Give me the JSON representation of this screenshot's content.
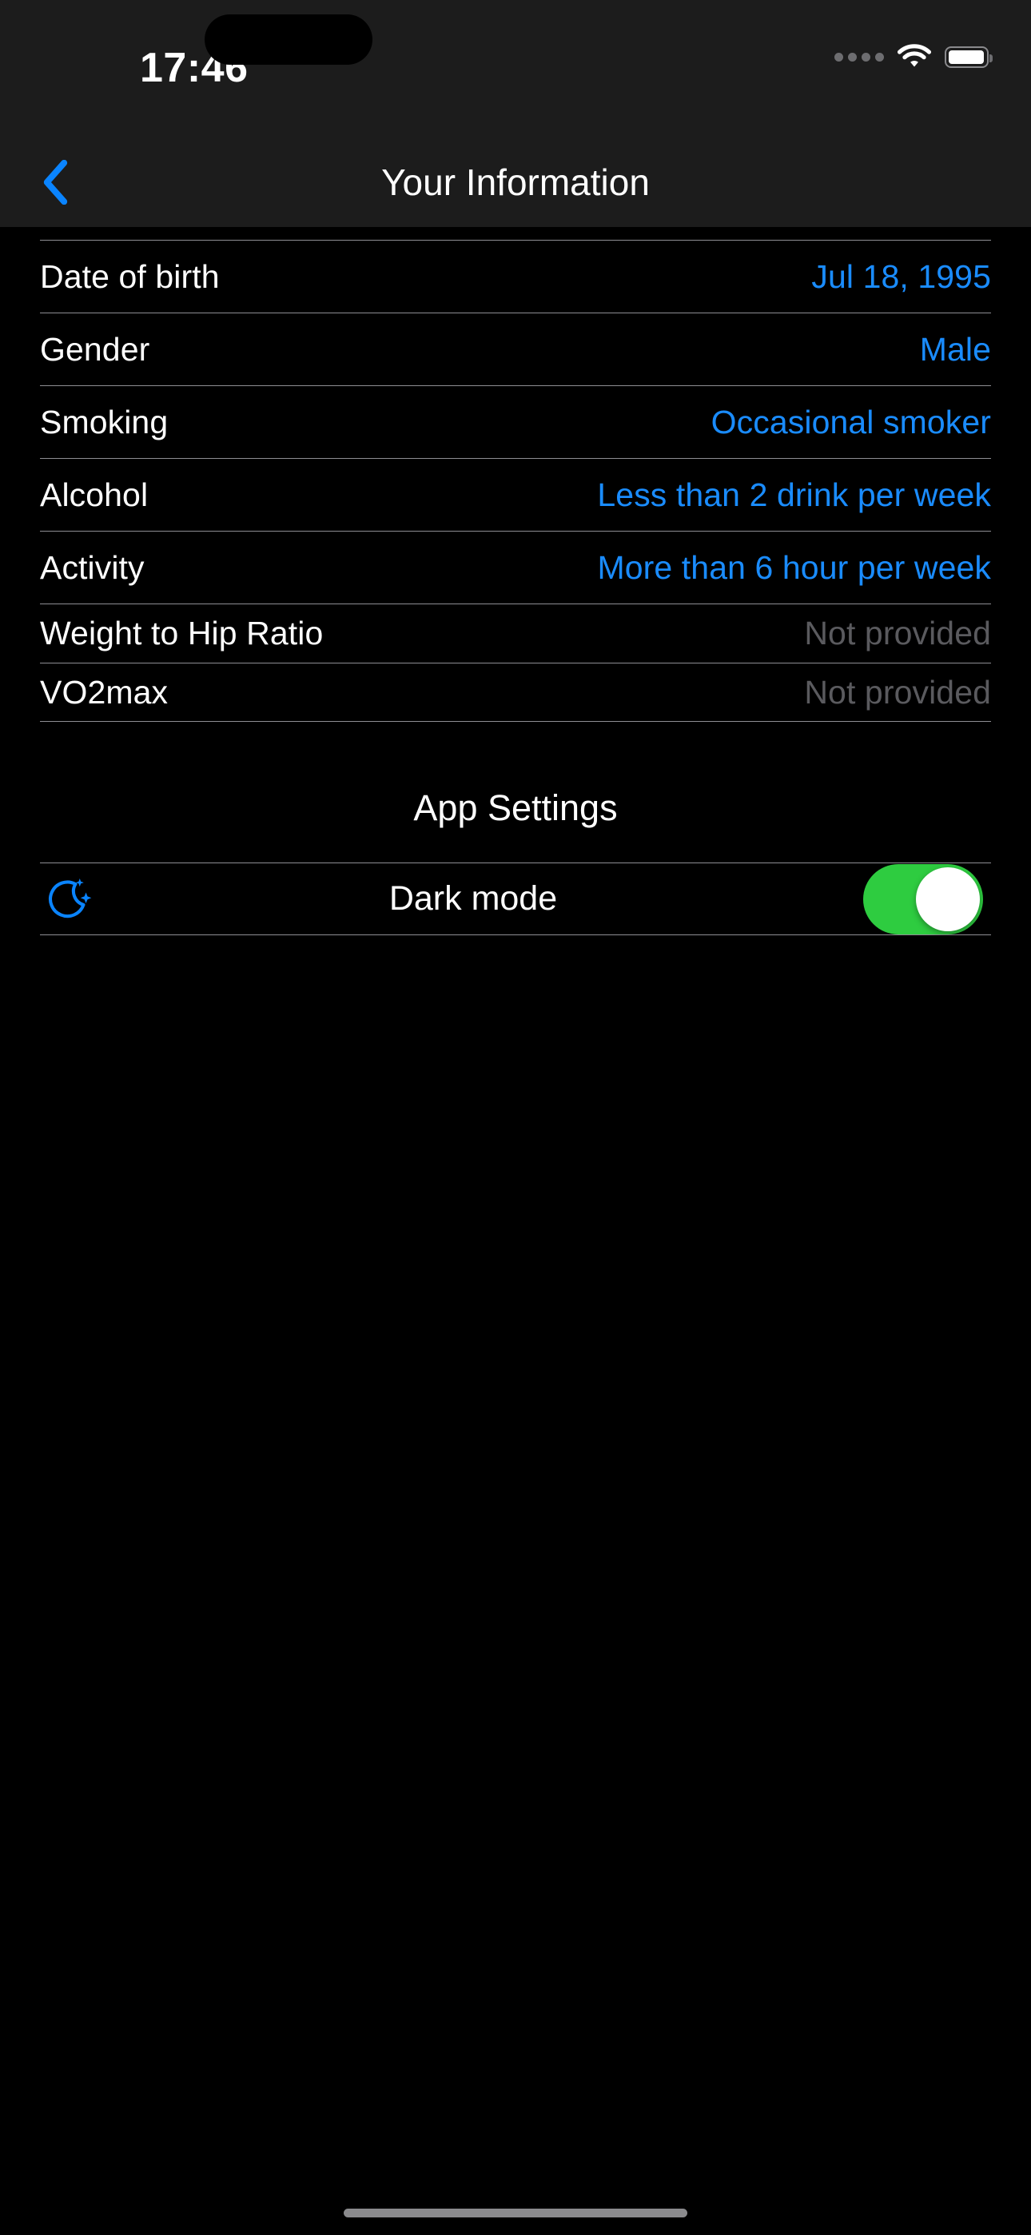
{
  "status_bar": {
    "time": "17:46",
    "cellular_icon": "cellular-dots-icon",
    "wifi_icon": "wifi-icon",
    "battery_icon": "battery-icon",
    "battery_level_pct": 88
  },
  "nav": {
    "back_icon": "chevron-left-icon",
    "title": "Your Information"
  },
  "info_rows": [
    {
      "label": "Date of birth",
      "value": "Jul 18, 1995",
      "provided": true
    },
    {
      "label": "Gender",
      "value": "Male",
      "provided": true
    },
    {
      "label": "Smoking",
      "value": "Occasional smoker",
      "provided": true
    },
    {
      "label": "Alcohol",
      "value": "Less than 2 drink per week",
      "provided": true
    },
    {
      "label": "Activity",
      "value": "More than 6 hour per week",
      "provided": true
    },
    {
      "label": "Weight to Hip Ratio",
      "value": "Not provided",
      "provided": false
    },
    {
      "label": "VO2max",
      "value": "Not provided",
      "provided": false
    }
  ],
  "app_settings": {
    "section_title": "App Settings",
    "dark_mode": {
      "icon": "moon-stars-icon",
      "label": "Dark mode",
      "enabled": true
    }
  },
  "colors": {
    "background": "#000000",
    "chrome": "#1c1c1c",
    "accent_blue": "#1a8cff",
    "value_blue": "#1a8cff",
    "muted_gray": "#5a5a5e",
    "separator": "#8e8e93",
    "toggle_on_green": "#2ecc40",
    "text_primary": "#ffffff"
  },
  "home_indicator": "home-indicator"
}
